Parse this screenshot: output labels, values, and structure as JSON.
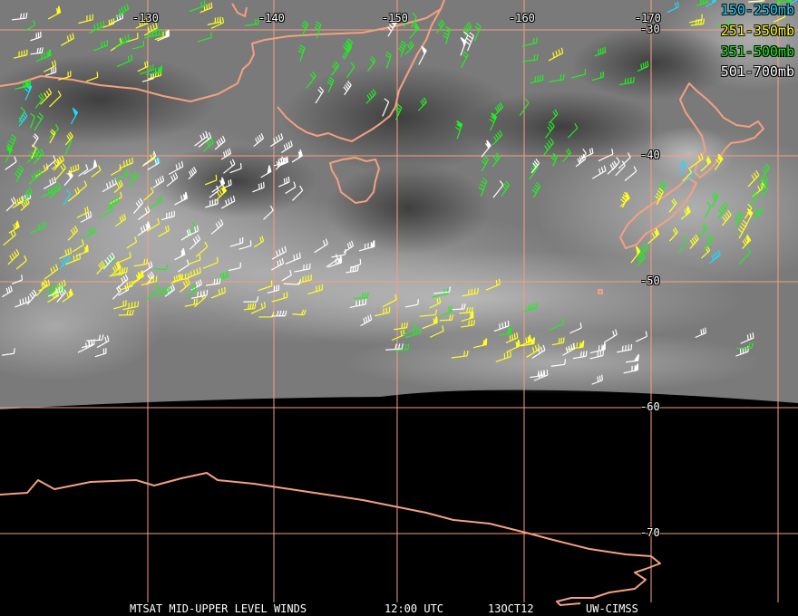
{
  "map": {
    "lon_labels": [
      "-130",
      "-140",
      "-150",
      "-160",
      "-170"
    ],
    "lat_labels": [
      "-30",
      "-40",
      "-50",
      "-60",
      "-70"
    ]
  },
  "legend": [
    {
      "label": "150-250mb",
      "color": "#22d8ff"
    },
    {
      "label": "251-350mb",
      "color": "#ffff22"
    },
    {
      "label": "351-500mb",
      "color": "#22ee22"
    },
    {
      "label": "501-700mb",
      "color": "#ffffff"
    }
  ],
  "footer": {
    "product": "MTSAT MID-UPPER LEVEL WINDS",
    "time": "12:00 UTC",
    "date": "13OCT12",
    "source": "UW-CIMSS"
  },
  "colors": {
    "coastline": "#f4a080",
    "grid": "#f4a080",
    "space": "#000000"
  }
}
